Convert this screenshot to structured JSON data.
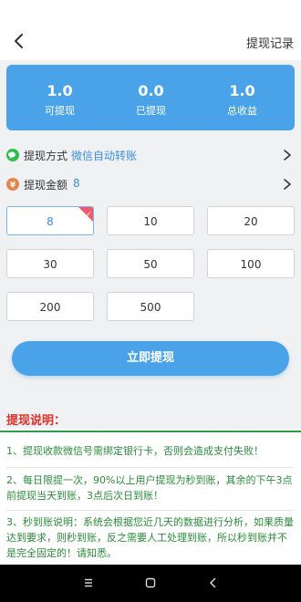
{
  "header": {
    "history_label": "提现记录"
  },
  "stats": [
    {
      "value": "1.0",
      "label": "可提现"
    },
    {
      "value": "0.0",
      "label": "已提现"
    },
    {
      "value": "1.0",
      "label": "总收益"
    }
  ],
  "method": {
    "label": "提现方式",
    "value": "微信自动转账"
  },
  "amount": {
    "label": "提现金额",
    "value": "8"
  },
  "amount_options": [
    "8",
    "10",
    "20",
    "30",
    "50",
    "100",
    "200",
    "500"
  ],
  "selected_amount": "8",
  "submit_label": "立即提现",
  "notes": {
    "title": "提现说明：",
    "items": [
      "1、提现收款微信号需绑定银行卡，否则会造成支付失败！",
      "2、每日限提一次，90%以上用户提现为秒到账，其余的下午3点前提现当天到账，3点后次日到账！",
      "3、秒到账说明：系统会根据您近几天的数据进行分析，如果质量达到要求，则秒到账，反之需要人工处理到账，所以秒到账并不是完全固定的！请知悉。"
    ]
  },
  "colors": {
    "accent": "#4aa2e8",
    "link": "#3a8ee6",
    "notes_title": "#e0302a",
    "notes_text": "#2a8c3a",
    "badge_red": "#ef5b6b",
    "wechat_green": "#2dbf4a",
    "amount_icon": "#e8834a"
  },
  "icons": {
    "back": "chevron-left-icon",
    "method": "wechat-icon",
    "amount": "yen-icon",
    "chevron": "chevron-right-icon",
    "nav": [
      "menu-icon",
      "home-icon",
      "back-icon"
    ]
  }
}
